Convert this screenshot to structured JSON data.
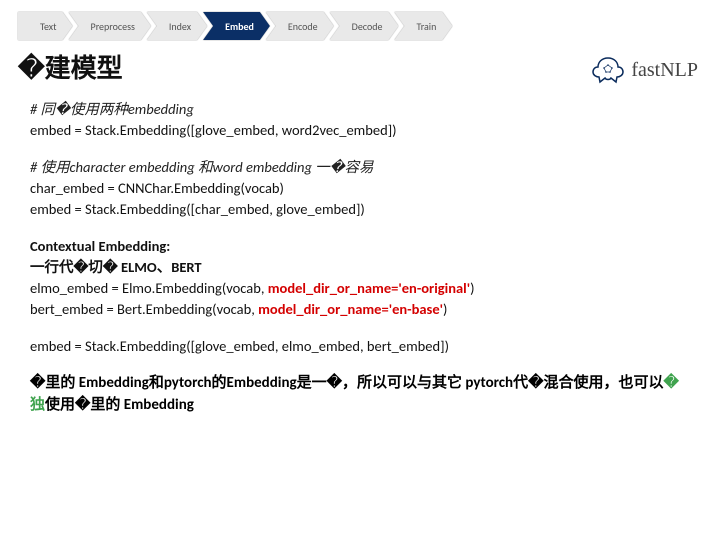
{
  "pipeline": {
    "items": [
      {
        "label": "Text",
        "active": false
      },
      {
        "label": "Preprocess",
        "active": false
      },
      {
        "label": "Index",
        "active": false
      },
      {
        "label": "Embed",
        "active": true
      },
      {
        "label": "Encode",
        "active": false
      },
      {
        "label": "Decode",
        "active": false
      },
      {
        "label": "Train",
        "active": false
      }
    ]
  },
  "title": "�建模型",
  "brand": {
    "name": "fastNLP",
    "icon": "brain-icon"
  },
  "blocks": {
    "b1": {
      "comment": "# 同�使用两种embedding",
      "line1": "embed = Stack.Embedding([glove_embed, word2vec_embed])"
    },
    "b2": {
      "comment": "# 使用character embedding 和word embedding 一�容易",
      "line1": "char_embed = CNNChar.Embedding(vocab)",
      "line2": "embed = Stack.Embedding([char_embed, glove_embed])"
    },
    "b3": {
      "heading": "Contextual Embedding:",
      "sub": "一行代�切� ELMO、BERT",
      "line1a": "elmo_embed = Elmo.Embedding(vocab, ",
      "line1b": "model_dir_or_name='en-original'",
      "line1c": ")",
      "line2a": "bert_embed = Bert.Embedding(vocab, ",
      "line2b": "model_dir_or_name='en-base'",
      "line2c": ")"
    },
    "b4": {
      "line1": "embed = Stack.Embedding([glove_embed, elmo_embed, bert_embed])"
    }
  },
  "footer": {
    "l1a": "�里的 Embedding和pytorch的Embedding是一�，所以可以与其它 pytorch代�混合使用，也可以",
    "l1b": "�独",
    "l1c": "使用�里的 Embedding"
  }
}
